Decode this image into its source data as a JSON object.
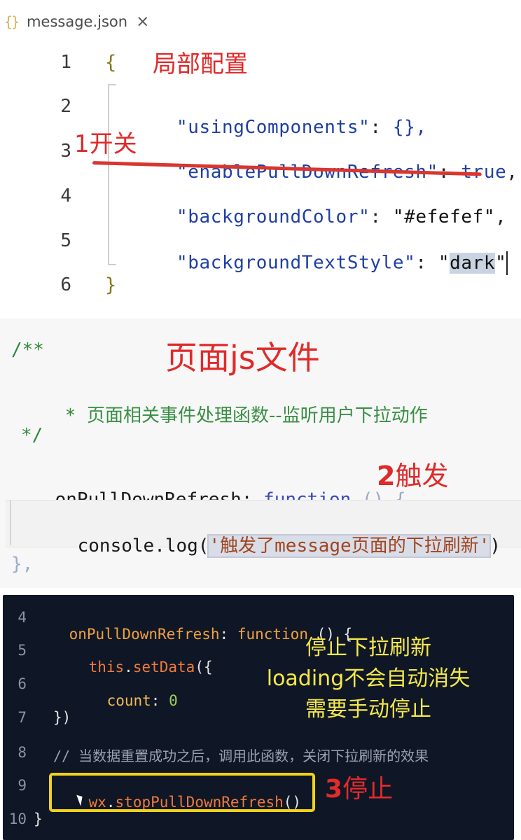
{
  "panel1": {
    "tab": {
      "icon": "{}",
      "filename": "message.json",
      "close": "×"
    },
    "title_label": "局部配置",
    "annotation": "1开关",
    "lines": [
      {
        "num": "1",
        "text": "{"
      },
      {
        "num": "2",
        "key": "\"usingComponents\"",
        "sep": ": ",
        "value": "{},",
        "value_color": "#1f3fa3"
      },
      {
        "num": "3",
        "key": "\"enablePullDownRefresh\"",
        "sep": ": ",
        "value": "true",
        "tail": ","
      },
      {
        "num": "4",
        "key": "\"backgroundColor\"",
        "sep": ": ",
        "value": "\"#efefef\"",
        "tail": ","
      },
      {
        "num": "5",
        "key": "\"backgroundTextStyle\"",
        "sep": ": ",
        "value_pre": "\"",
        "value_sel": "dark",
        "value_post": "\""
      },
      {
        "num": "6",
        "text": "}"
      }
    ]
  },
  "panel2": {
    "title_label": "页面js文件",
    "annotation_num": "2",
    "annotation_text": "触发",
    "comment_open": "/**",
    "comment_body_star": "* ",
    "comment_body": "页面相关事件处理函数--监听用户下拉动作",
    "comment_close": "*/",
    "fn_name": "onPullDownRefresh",
    "fn_colon": ": ",
    "fn_keyword": "function",
    "fn_parens": " () {",
    "console_call": "console.log(",
    "console_arg_q1": "'",
    "console_arg_cn1": "触发了",
    "console_arg_en": "message",
    "console_arg_cn2": "页面的下拉刷新",
    "console_arg_q2": "'",
    "console_close": ")",
    "closing": "},"
  },
  "panel3": {
    "annotation_lines": [
      "停止下拉刷新",
      "loading不会自动消失",
      "需要手动停止"
    ],
    "stop_num": "3",
    "stop_text": "停止",
    "lines": [
      {
        "num": "4",
        "fn": "onPullDownRefresh",
        "colon": ": ",
        "kw": "function",
        "rest": " () {"
      },
      {
        "num": "5",
        "this": "this",
        "dot": ".",
        "method": "setData",
        "rest": "({"
      },
      {
        "num": "6",
        "prop": "count",
        "colon": ": ",
        "value": "0"
      },
      {
        "num": "7",
        "text": "})"
      },
      {
        "num": "8",
        "comment": "// 当数据重置成功之后，调用此函数，关闭下拉刷新的效果"
      },
      {
        "num": "9",
        "obj": "wx",
        "dot": ".",
        "method": "stopPullDownRefresh",
        "rest": "()"
      },
      {
        "num": "10",
        "text": "}"
      }
    ]
  }
}
